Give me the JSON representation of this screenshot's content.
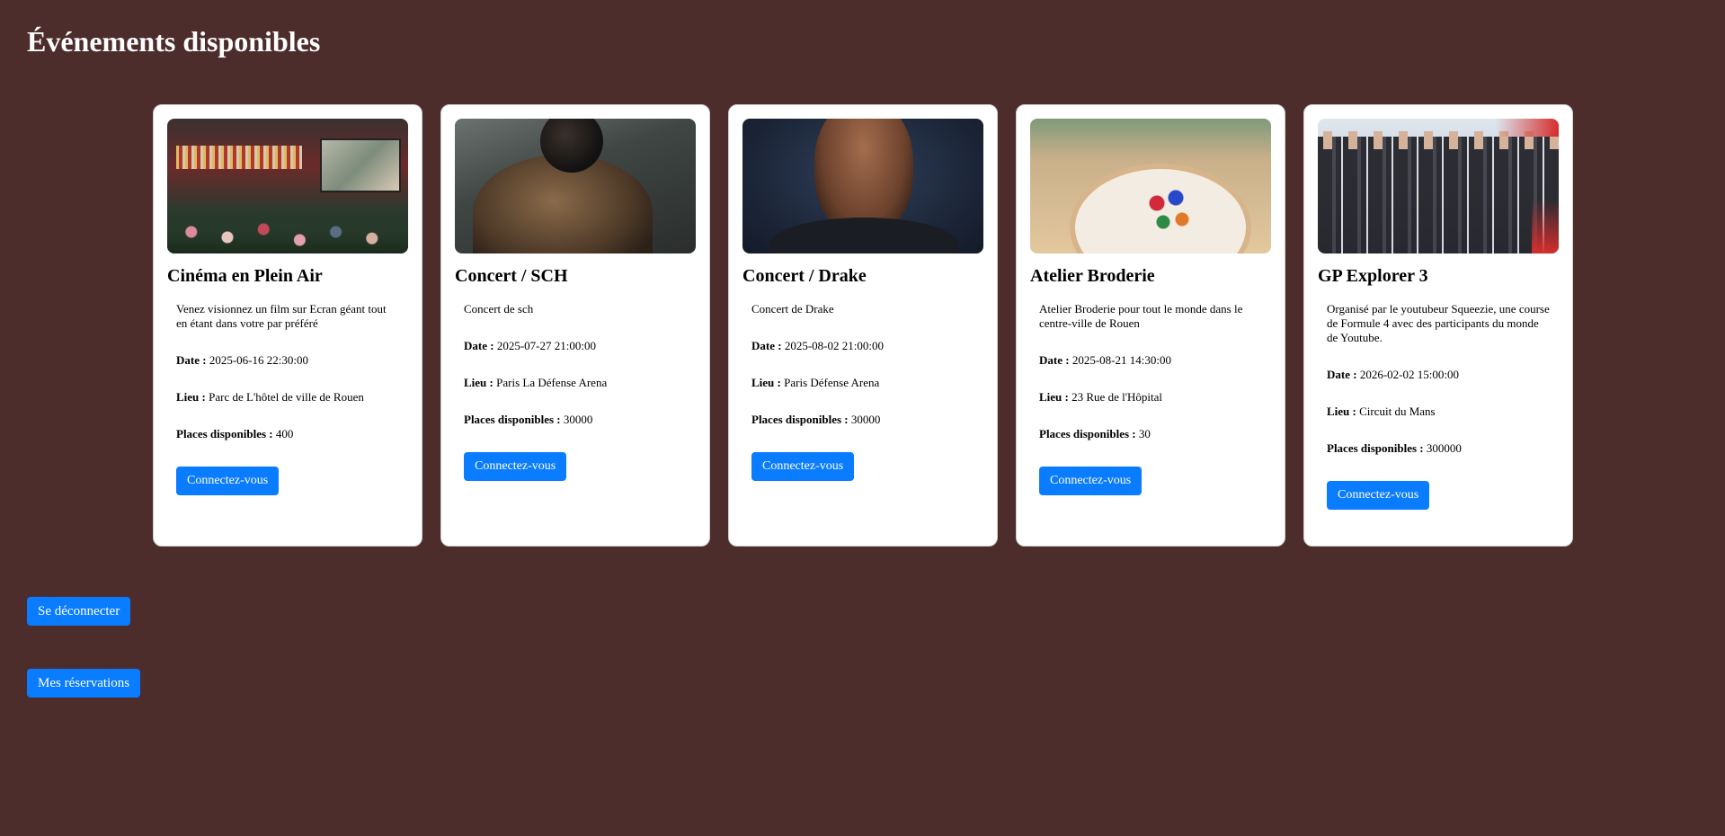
{
  "page": {
    "title": "Événements disponibles"
  },
  "labels": {
    "date": "Date :",
    "lieu": "Lieu :",
    "places": "Places disponibles :"
  },
  "events": [
    {
      "title": "Cinéma en Plein Air",
      "description": "Venez visionnez un film sur Ecran géant tout en étant dans votre par préféré",
      "date": "2025-06-16 22:30:00",
      "lieu": "Parc de L'hôtel de ville de Rouen",
      "places": "400",
      "button": "Connectez-vous"
    },
    {
      "title": "Concert / SCH",
      "description": "Concert de sch",
      "date": "2025-07-27 21:00:00",
      "lieu": "Paris La Défense Arena",
      "places": "30000",
      "button": "Connectez-vous"
    },
    {
      "title": "Concert / Drake",
      "description": "Concert de Drake",
      "date": "2025-08-02 21:00:00",
      "lieu": "Paris Défense Arena",
      "places": "30000",
      "button": "Connectez-vous"
    },
    {
      "title": "Atelier Broderie",
      "description": "Atelier Broderie pour tout le monde dans le centre-ville de Rouen",
      "date": "2025-08-21 14:30:00",
      "lieu": "23 Rue de l'Hôpital",
      "places": "30",
      "button": "Connectez-vous"
    },
    {
      "title": "GP Explorer 3",
      "description": "Organisé par le youtubeur Squeezie, une course de Formule 4 avec des participants du monde de Youtube.",
      "date": "2026-02-02 15:00:00",
      "lieu": "Circuit du Mans",
      "places": "300000",
      "button": "Connectez-vous"
    }
  ],
  "actions": {
    "logout": "Se déconnecter",
    "reservations": "Mes réservations"
  },
  "colors": {
    "background": "#4d2c2c",
    "button": "#0a7cff",
    "card": "#ffffff"
  }
}
